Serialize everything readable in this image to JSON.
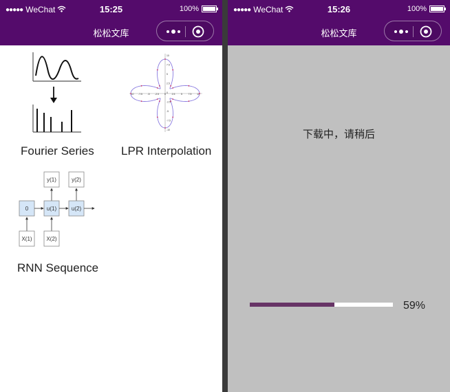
{
  "left_screen": {
    "status": {
      "carrier": "WeChat",
      "time": "15:25",
      "battery": "100%"
    },
    "nav": {
      "title": "松松文库"
    },
    "cards": [
      {
        "label": "Fourier Series",
        "icon": "fourier-series-icon"
      },
      {
        "label": "LPR Interpolation",
        "icon": "lpr-interpolation-plot-icon"
      },
      {
        "label": "RNN Sequence",
        "icon": "rnn-sequence-diagram-icon"
      }
    ],
    "lpr_ticks_x": [
      "-10",
      "-7.5",
      "-5",
      "-2.5",
      "0",
      "2.5",
      "5",
      "7.5",
      "10"
    ],
    "lpr_ticks_y": [
      "10",
      "7.5",
      "5",
      "2.5",
      "0",
      "-2.5",
      "-5",
      "-7.5",
      "-10"
    ],
    "rnn": {
      "init": "0",
      "outputs": [
        "y(1)",
        "y(2)"
      ],
      "states": [
        "u(1)",
        "u(2)"
      ],
      "inputs": [
        "X(1)",
        "X(2)"
      ]
    }
  },
  "right_screen": {
    "status": {
      "carrier": "WeChat",
      "time": "15:26",
      "battery": "100%"
    },
    "nav": {
      "title": "松松文库"
    },
    "loading_text": "下载中，请稍后",
    "progress": {
      "percent": 59,
      "label": "59%"
    }
  },
  "colors": {
    "brand": "#540b6b",
    "progress_fill": "#673466",
    "progress_track": "#ffffff",
    "loading_background": "#c0c0c0",
    "lpr_curve": "#8a7be0",
    "lpr_points": "#cc3366",
    "rnn_box": "#d5e6f7"
  }
}
